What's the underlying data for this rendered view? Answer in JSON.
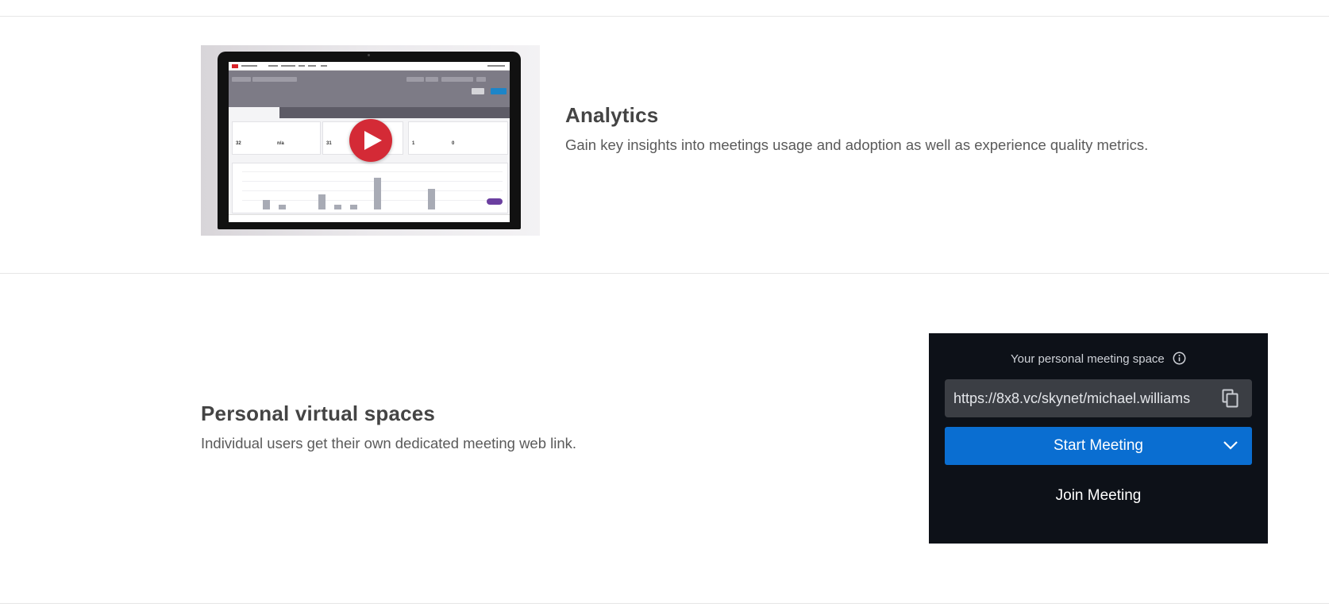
{
  "analytics": {
    "title": "Analytics",
    "description": "Gain key insights into meetings usage and adoption as well as experience quality metrics.",
    "video": {
      "play_icon": "play-icon",
      "play_color": "#d42a36"
    }
  },
  "personal_spaces": {
    "title": "Personal virtual spaces",
    "description": "Individual users get their own dedicated meeting web link."
  },
  "meeting_widget": {
    "label": "Your personal meeting space",
    "info_icon": "info-icon",
    "url": "https://8x8.vc/skynet/michael.williams",
    "copy_icon": "copy-icon",
    "start_label": "Start Meeting",
    "start_dropdown_icon": "chevron-down-icon",
    "join_label": "Join Meeting",
    "colors": {
      "background": "#0d1118",
      "url_box": "#3b3e44",
      "primary": "#0a6ed1"
    }
  }
}
